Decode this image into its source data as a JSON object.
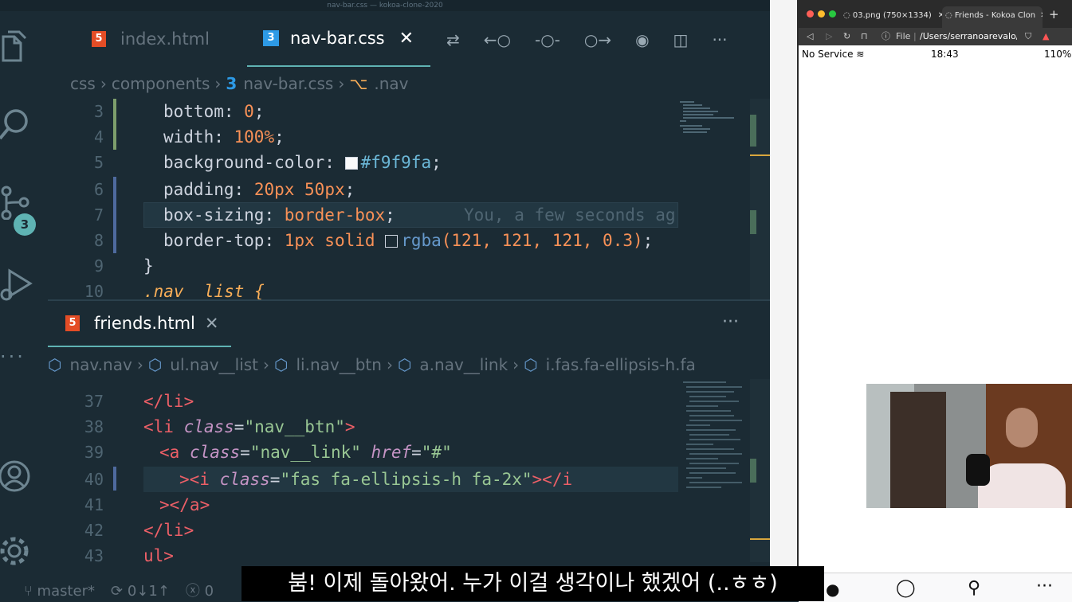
{
  "window": {
    "title": "nav-bar.css — kokoa-clone-2020"
  },
  "activity": {
    "scm_badge": "3"
  },
  "top_pane": {
    "tabs": [
      {
        "label": "index.html",
        "active": false
      },
      {
        "label": "nav-bar.css",
        "active": true
      }
    ],
    "breadcrumb": [
      "css",
      "components",
      "nav-bar.css",
      ".nav"
    ],
    "line_numbers": [
      "3",
      "4",
      "5",
      "6",
      "7",
      "8",
      "9",
      "10"
    ],
    "blame": "You, a few seconds ag",
    "code": {
      "l3_prop": "bottom",
      "l3_val": "0",
      "l4_prop": "width",
      "l4_val": "100%",
      "l5_prop": "background-color",
      "l5_val": "#f9f9fa",
      "l6_prop": "padding",
      "l6_val": "20px 50px",
      "l7_prop": "box-sizing",
      "l7_val": "border-box",
      "l8_prop": "border-top",
      "l8_val1": "1px solid",
      "l8_fn": "rgba",
      "l8_args": "(121, 121, 121, 0.3)",
      "l9": "}",
      "l10": ".nav__list {"
    }
  },
  "bottom_pane": {
    "tab": {
      "label": "friends.html"
    },
    "breadcrumb": [
      "nav.nav",
      "ul.nav__list",
      "li.nav__btn",
      "a.nav__link",
      "i.fas.fa-ellipsis-h.fa"
    ],
    "line_numbers": [
      "37",
      "38",
      "39",
      "40",
      "41",
      "42",
      "43"
    ],
    "code": {
      "l37": "</li>",
      "l38_open": "<li ",
      "l38_attr": "class",
      "l38_eq": "=",
      "l38_str": "\"nav__btn\"",
      "l38_close": ">",
      "l39_open": "<a ",
      "l39_attr1": "class",
      "l39_str1": "\"nav__link\"",
      "l39_attr2": "href",
      "l39_str2": "\"#\"",
      "l40_open": "><i ",
      "l40_attr": "class",
      "l40_str": "\"fas fa-ellipsis-h fa-2x\"",
      "l40_close": "></i",
      "l41": "></a>",
      "l42": "</li>",
      "l43": "ul>"
    }
  },
  "statusbar": {
    "branch": "master*",
    "sync": "0↓1↑",
    "errors": "0"
  },
  "browser": {
    "tabs": [
      {
        "label": "03.png (750×1334)"
      },
      {
        "label": "Friends - Kokoa Clon"
      }
    ],
    "address": {
      "scheme": "File",
      "path": "/Users/serranoarevalo/..."
    },
    "phone_status": {
      "carrier": "No Service",
      "time": "18:43",
      "battery": "110%"
    }
  },
  "subtitle": "붐! 이제 돌아왔어. 누가 이걸 생각이나 했겠어 (..ㅎㅎ)",
  "colors": {
    "editor_bg": "#1b2b34",
    "accent": "#5fb3b3",
    "tag": "#ec5f67",
    "number": "#f99157",
    "string": "#99c794"
  }
}
